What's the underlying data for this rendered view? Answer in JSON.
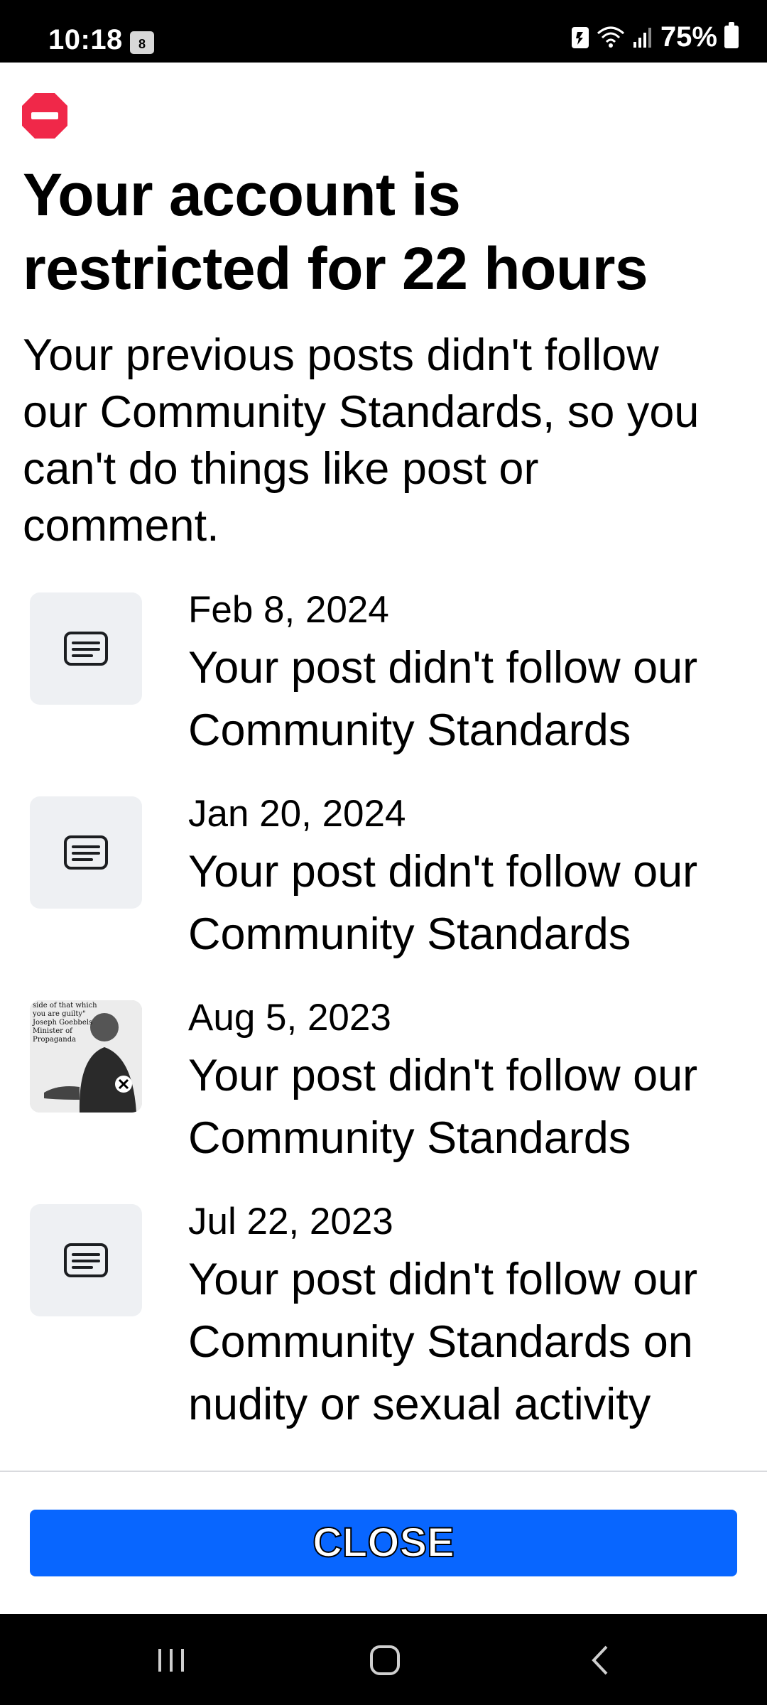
{
  "status_bar": {
    "time": "10:18",
    "calendar_day": "8",
    "battery": "75%"
  },
  "dialog": {
    "title": "Your account is restricted for 22 hours",
    "subtitle": "Your previous posts didn't follow our Community Standards, so you can't do things like post or comment.",
    "items": [
      {
        "date": "Feb 8, 2024",
        "message": "Your post didn't follow our Community Standards",
        "thumbnail": "document-icon"
      },
      {
        "date": "Jan 20, 2024",
        "message": "Your post didn't follow our Community Standards",
        "thumbnail": "document-icon"
      },
      {
        "date": "Aug 5, 2023",
        "message": "Your post didn't follow our Community Standards",
        "thumbnail": "post-image",
        "thumbnail_caption": "side of that which you are guilty\" Joseph Goebbels Minister of Propaganda"
      },
      {
        "date": "Jul 22, 2023",
        "message": "Your post didn't follow our Community Standards on nudity or sexual activity",
        "thumbnail": "document-icon"
      }
    ],
    "close_label": "CLOSE"
  },
  "colors": {
    "accent": "#0866ff",
    "stop_red": "#f02849",
    "thumb_bg": "#eef0f3"
  }
}
